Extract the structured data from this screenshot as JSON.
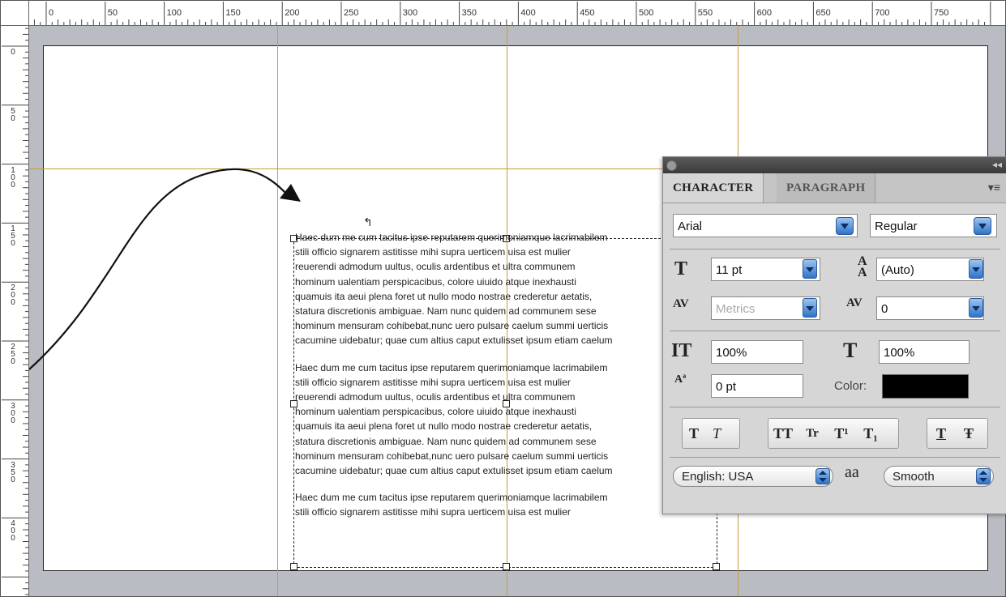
{
  "rulers": {
    "top_labels": [
      "0",
      "50",
      "100",
      "150",
      "200",
      "250",
      "300",
      "350",
      "400",
      "450",
      "500",
      "550",
      "600",
      "650",
      "700",
      "750"
    ],
    "left_labels": [
      [
        "0"
      ],
      [
        "5",
        "0"
      ],
      [
        "1",
        "0",
        "0"
      ],
      [
        "1",
        "5",
        "0"
      ],
      [
        "2",
        "0",
        "0"
      ],
      [
        "2",
        "5",
        "0"
      ],
      [
        "3",
        "0",
        "0"
      ],
      [
        "3",
        "5",
        "0"
      ],
      [
        "4",
        "0",
        "0"
      ]
    ]
  },
  "text_frame": {
    "paragraphs": [
      [
        "Haec dum me cum tacitus ipse reputarem querimoniamque lacrimabilem",
        "stili officio signarem astitisse mihi supra uerticem uisa est mulier",
        "reuerendi admodum uultus, oculis ardentibus et ultra communem",
        "hominum ualentiam perspicacibus, colore uiuido atque inexhausti",
        "quamuis ita aeui plena foret ut nullo modo nostrae crederetur aetatis,",
        "statura discretionis ambiguae. Nam nunc quidem ad communem sese",
        "hominum mensuram cohibebat,nunc uero pulsare caelum summi uerticis",
        "cacumine uidebatur; quae cum altius caput extulisset ipsum etiam caelum"
      ],
      [
        "Haec dum me cum tacitus ipse reputarem querimoniamque lacrimabilem",
        "stili officio signarem astitisse mihi supra uerticem uisa est mulier",
        "reuerendi admodum uultus, oculis ardentibus et ultra communem",
        "hominum ualentiam perspicacibus, colore uiuido atque inexhausti",
        "quamuis ita aeui plena foret ut nullo modo nostrae crederetur aetatis,",
        "statura discretionis ambiguae. Nam nunc quidem ad communem sese",
        "hominum mensuram cohibebat,nunc uero pulsare caelum summi uerticis",
        "cacumine uidebatur; quae cum altius caput extulisset ipsum etiam caelum"
      ],
      [
        "Haec dum me cum tacitus ipse reputarem querimoniamque lacrimabilem",
        "stili officio signarem astitisse mihi supra uerticem uisa est mulier"
      ]
    ]
  },
  "panel": {
    "tabs": [
      "CHARACTER",
      "PARAGRAPH"
    ],
    "font_family": "Arial",
    "font_style": "Regular",
    "font_size": "11 pt",
    "leading": "(Auto)",
    "kerning": "Metrics",
    "tracking": "0",
    "vertical_scale": "100%",
    "horizontal_scale": "100%",
    "baseline_shift": "0 pt",
    "color_label": "Color:",
    "color_value": "#000000",
    "language": "English: USA",
    "antialias": "Smooth",
    "antialias_icon": "aa",
    "style_buttons": [
      "T",
      "T",
      "TT",
      "Tr",
      "T¹",
      "T₁",
      "T",
      "Ŧ"
    ]
  },
  "colors": {
    "guide": "#c99b3b",
    "pasteboard": "#b9bcc2",
    "accent_blue": "#2f73c9"
  }
}
